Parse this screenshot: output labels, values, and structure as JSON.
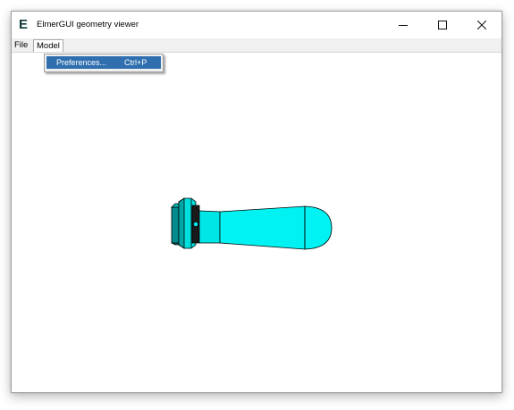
{
  "window": {
    "app_icon": "E",
    "title": "ElmerGUI geometry viewer"
  },
  "caption_buttons": {
    "minimize": "minimize-icon",
    "maximize": "maximize-icon",
    "close": "close-icon"
  },
  "menubar": {
    "file_label": "File",
    "model_label": "Model"
  },
  "model_menu": {
    "items": [
      {
        "label": "Preferences...",
        "shortcut": "Ctrl+P"
      }
    ]
  },
  "colors": {
    "menu_highlight": "#2f6fb0",
    "model_fill": "#00e6e6",
    "model_dark": "#008c8c"
  }
}
